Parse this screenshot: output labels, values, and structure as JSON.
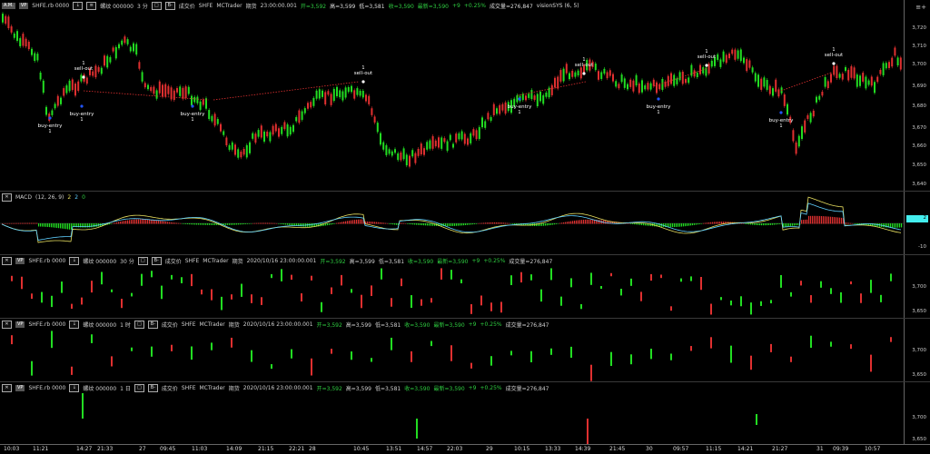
{
  "panes": [
    {
      "id": "main",
      "header": {
        "left_buttons": [
          "A.M.",
          "VP"
        ],
        "instrument": "SHFE.rb 0000",
        "mid_buttons": [
          "↓",
          "≡"
        ],
        "name": "螺纹 000000",
        "period": "3 分",
        "controls": [
          "□",
          "B-"
        ],
        "fields": [
          "成交价",
          "SHFE",
          "MCTrader",
          "期货"
        ],
        "time": "23:00:00.001",
        "open": "开=3,592",
        "high": "高=3,599",
        "low": "低=3,581",
        "close": "收=3,590",
        "last": "最新=3,590",
        "change": "+9",
        "pct": "+0.25%",
        "volume": "成交量=276,847",
        "indicator": "visionSYS (6, 5)"
      },
      "yticks": [
        "3,720",
        "3,710",
        "3,700",
        "3,690",
        "3,680",
        "3,670",
        "3,660",
        "3,650",
        "3,640"
      ],
      "corner_icon": "≡+",
      "signals": [
        {
          "label": "buy-entry",
          "qty": "1"
        },
        {
          "label": "sell-out",
          "qty": "1"
        },
        {
          "label": "buy-entry",
          "qty": "1"
        },
        {
          "label": "buy-entry",
          "qty": "1"
        },
        {
          "label": "sell-out",
          "qty": "1"
        },
        {
          "label": "buy-entry",
          "qty": "1"
        },
        {
          "label": "sell-out",
          "qty": "1"
        },
        {
          "label": "buy-entry",
          "qty": "1"
        },
        {
          "label": "sell-out",
          "qty": "1"
        },
        {
          "label": "buy-entry",
          "qty": "1"
        },
        {
          "label": "sell-out",
          "qty": "1"
        }
      ]
    },
    {
      "id": "macd",
      "header": {
        "name": "MACD",
        "params": "(12, 26, 9)",
        "v1": "2",
        "v2": "2",
        "v3": "0"
      },
      "yticks": [
        "2",
        "-10"
      ]
    },
    {
      "id": "m30",
      "header": {
        "instrument": "SHFE.rb 0000",
        "name": "螺纹 000000",
        "period": "30 分",
        "fields": [
          "成交价",
          "SHFE",
          "MCTrader",
          "期货"
        ],
        "time": "2020/10/16 23:00:00.001",
        "open": "开=3,592",
        "high": "高=3,599",
        "low": "低=3,581",
        "close": "收=3,590",
        "last": "最新=3,590",
        "change": "+9",
        "pct": "+0.25%",
        "volume": "成交量=276,847"
      },
      "yticks": [
        "3,700",
        "3,650"
      ]
    },
    {
      "id": "h1",
      "header": {
        "instrument": "SHFE.rb 0000",
        "name": "螺纹 000000",
        "period": "1 时",
        "fields": [
          "成交价",
          "SHFE",
          "MCTrader",
          "期货"
        ],
        "time": "2020/10/16 23:00:00.001",
        "open": "开=3,592",
        "high": "高=3,599",
        "low": "低=3,581",
        "close": "收=3,590",
        "last": "最新=3,590",
        "change": "+9",
        "pct": "+0.25%",
        "volume": "成交量=276,847"
      },
      "yticks": [
        "3,700",
        "3,650"
      ]
    },
    {
      "id": "d1",
      "header": {
        "instrument": "SHFE.rb 0000",
        "name": "螺纹 000000",
        "period": "1 日",
        "fields": [
          "成交价",
          "SHFE",
          "MCTrader",
          "期货"
        ],
        "time": "2020/10/16 23:00:00.001",
        "open": "开=3,592",
        "high": "高=3,599",
        "low": "低=3,581",
        "close": "收=3,590",
        "last": "最新=3,590",
        "change": "+9",
        "pct": "+0.25%",
        "volume": "成交量=276,847"
      },
      "yticks": [
        "3,700",
        "3,650"
      ]
    }
  ],
  "xticks": [
    "10:03",
    "11:21",
    "14:27",
    "21:33",
    "27",
    "09:45",
    "11:03",
    "14:09",
    "21:15",
    "22:21",
    "28",
    "10:45",
    "13:51",
    "14:57",
    "22:03",
    "29",
    "10:15",
    "13:33",
    "14:39",
    "21:45",
    "30",
    "09:57",
    "11:15",
    "14:21",
    "21:27",
    "31",
    "09:39",
    "10:57"
  ],
  "colors": {
    "up": "#e03030",
    "down": "#22dd22",
    "macd_a": "#e8e060",
    "macd_b": "#60d0ff",
    "signal_line": "#e03030"
  }
}
